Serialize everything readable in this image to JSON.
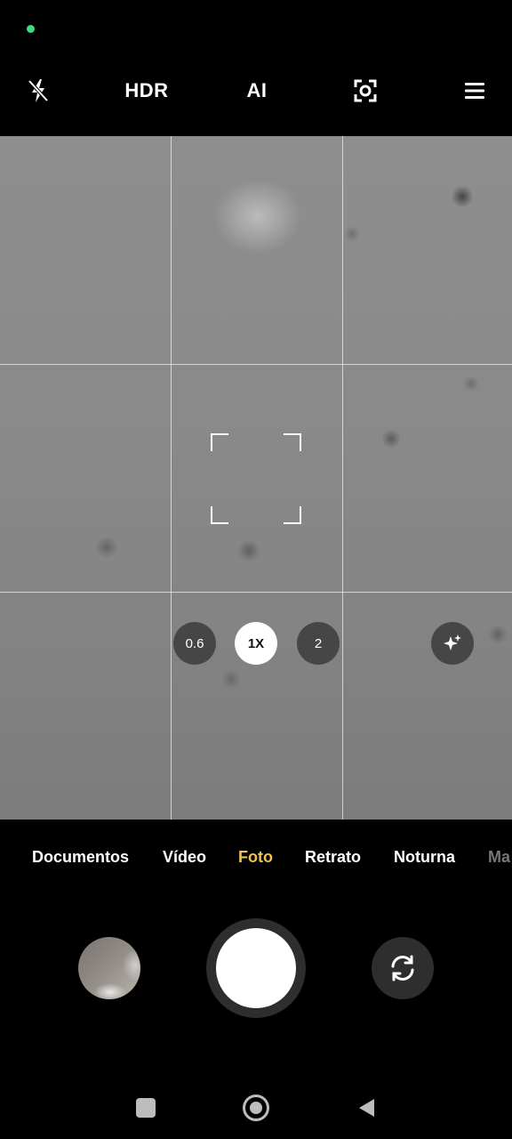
{
  "status": {
    "indicator_color": "#3ddc84"
  },
  "toolbar": {
    "flash_icon": "flash-off-icon",
    "hdr_label": "HDR",
    "ai_label": "AI",
    "lens_icon": "focus-frame-icon",
    "menu_icon": "menu-icon"
  },
  "viewfinder": {
    "grid": true,
    "focus_indicator": "focus-bracket-icon"
  },
  "zoom": {
    "options": [
      "0.6",
      "1X",
      "2"
    ],
    "selected": "1X",
    "effects_icon": "sparkle-filter-icon"
  },
  "modes": {
    "items": [
      "Documentos",
      "Vídeo",
      "Foto",
      "Retrato",
      "Noturna",
      "Ma"
    ],
    "active": "Foto",
    "active_color": "#f5c14b"
  },
  "controls": {
    "gallery_icon": "gallery-thumbnail",
    "shutter_icon": "shutter-button-icon",
    "switch_icon": "switch-camera-icon"
  },
  "navigation": {
    "recents_icon": "square-icon",
    "home_icon": "circle-icon",
    "back_icon": "triangle-back-icon"
  }
}
